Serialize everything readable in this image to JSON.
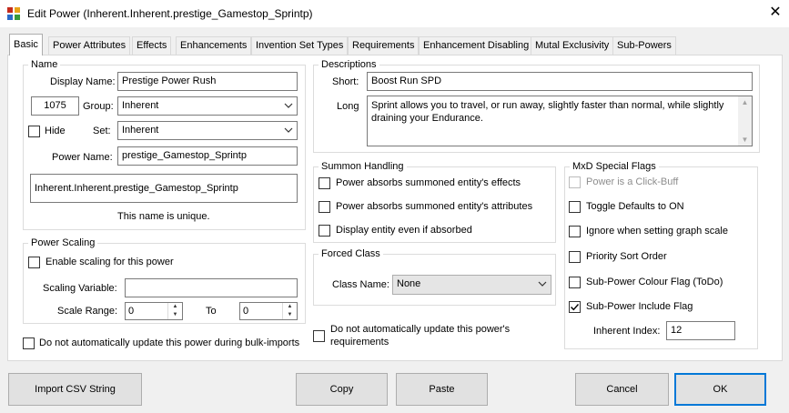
{
  "window": {
    "title": "Edit Power (Inherent.Inherent.prestige_Gamestop_Sprintp)",
    "close_glyph": "✕"
  },
  "tabs": [
    {
      "label": "Basic",
      "active": true
    },
    {
      "label": "Power Attributes"
    },
    {
      "label": "Effects"
    },
    {
      "label": "Enhancements"
    },
    {
      "label": "Invention Set Types"
    },
    {
      "label": "Requirements"
    },
    {
      "label": "Enhancement Disabling"
    },
    {
      "label": "Mutal Exclusivity"
    },
    {
      "label": "Sub-Powers"
    }
  ],
  "name_group": {
    "title": "Name",
    "display_name_label": "Display Name:",
    "display_name_value": "Prestige Power Rush",
    "power_index_value": "1075",
    "group_label": "Group:",
    "group_value": "Inherent",
    "hide_label": "Hide",
    "hide_checked": false,
    "set_label": "Set:",
    "set_value": "Inherent",
    "power_name_label": "Power Name:",
    "power_name_value": "prestige_Gamestop_Sprintp",
    "full_name_value": "Inherent.Inherent.prestige_Gamestop_Sprintp",
    "unique_status": "This name is unique."
  },
  "power_scaling": {
    "title": "Power Scaling",
    "enable_label": "Enable scaling for this power",
    "enable_checked": false,
    "scaling_variable_label": "Scaling Variable:",
    "scaling_variable_value": "",
    "scale_range_label": "Scale Range:",
    "range_from": "0",
    "to_label": "To",
    "range_to": "0"
  },
  "no_bulk_import_label": "Do not automatically update this power during bulk-imports",
  "descriptions": {
    "title": "Descriptions",
    "short_label": "Short:",
    "short_value": "Boost Run SPD",
    "long_label": "Long",
    "long_value": "Sprint allows you to travel, or run away, slightly faster than normal, while slightly draining your Endurance."
  },
  "summon_handling": {
    "title": "Summon Handling",
    "options": [
      {
        "label": "Power absorbs summoned entity's effects",
        "checked": false
      },
      {
        "label": "Power absorbs summoned entity's attributes",
        "checked": false
      },
      {
        "label": "Display entity even if absorbed",
        "checked": false
      }
    ]
  },
  "forced_class": {
    "title": "Forced Class",
    "class_name_label": "Class Name:",
    "class_name_value": "None"
  },
  "no_update_requirements_label": "Do not automatically update this power's requirements",
  "mxd_flags": {
    "title": "MxD Special Flags",
    "flags": [
      {
        "label": "Power is a Click-Buff",
        "checked": false,
        "disabled": true
      },
      {
        "label": "Toggle Defaults to ON",
        "checked": false
      },
      {
        "label": "Ignore when setting graph scale",
        "checked": false
      },
      {
        "label": "Priority Sort Order",
        "checked": false
      },
      {
        "label": "Sub-Power Colour Flag (ToDo)",
        "checked": false
      },
      {
        "label": "Sub-Power Include Flag",
        "checked": true
      }
    ],
    "inherent_index_label": "Inherent Index:",
    "inherent_index_value": "12"
  },
  "buttons": {
    "import_csv": "Import CSV String",
    "copy": "Copy",
    "paste": "Paste",
    "cancel": "Cancel",
    "ok": "OK"
  },
  "colors": {
    "focus_border": "#0078d7",
    "icon_red": "#c42b1c",
    "icon_blue": "#2a6ac8"
  }
}
